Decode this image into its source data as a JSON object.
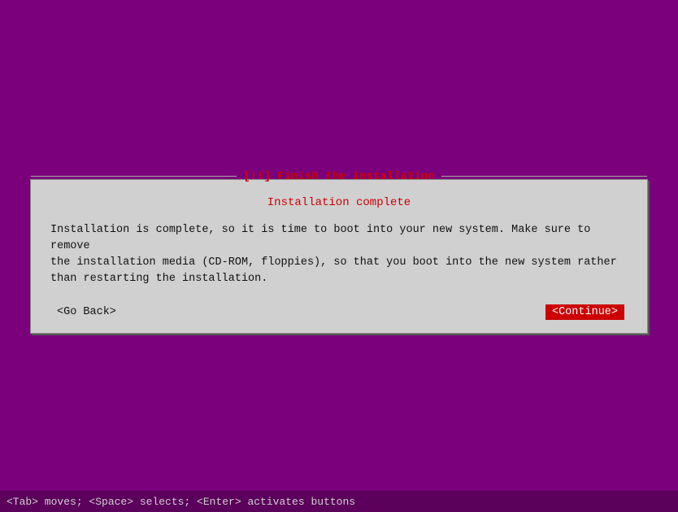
{
  "background": {
    "color": "#8B008B"
  },
  "dialog": {
    "title": "[!!] Finish the installation",
    "subtitle": "Installation complete",
    "message": "Installation is complete, so it is time to boot into your new system. Make sure to remove\nthe installation media (CD-ROM, floppies), so that you boot into the new system rather\nthan restarting the installation.",
    "go_back_label": "<Go Back>",
    "continue_label": "<Continue>"
  },
  "status_bar": {
    "text": "<Tab> moves; <Space> selects; <Enter> activates buttons"
  }
}
